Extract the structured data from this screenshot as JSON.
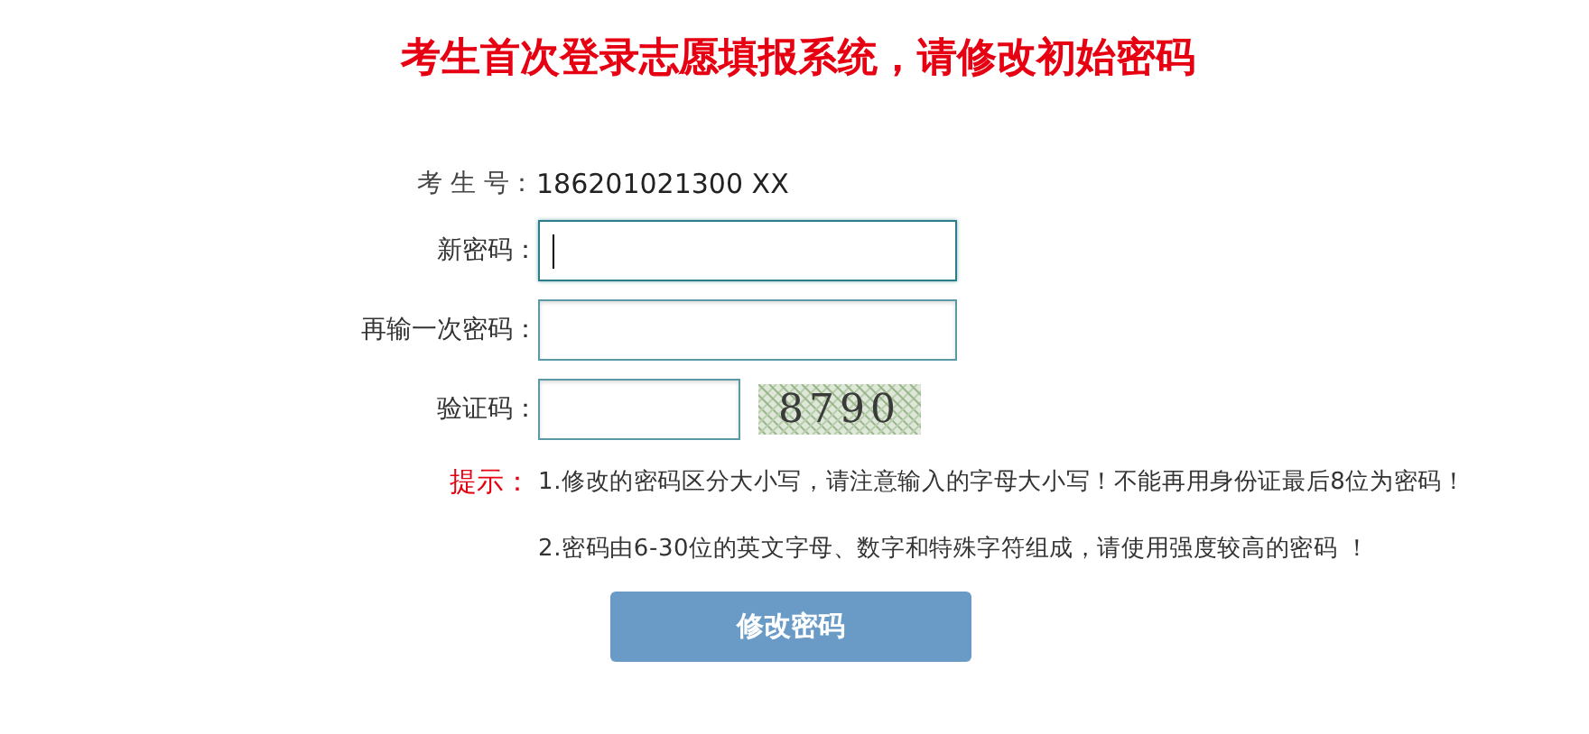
{
  "title": "考生首次登录志愿填报系统，请修改初始密码",
  "candidate": {
    "label": "考 生 号：",
    "value": "186201021300 XX"
  },
  "fields": [
    {
      "kind": "password",
      "label": "新密码：",
      "focused": true
    },
    {
      "kind": "password",
      "label": "再输一次密码：",
      "focused": false
    },
    {
      "kind": "captcha",
      "label": "验证码：",
      "focused": false,
      "captcha": "8790"
    }
  ],
  "tips": {
    "label": "提示：",
    "lines": [
      "1.修改的密码区分大小写，请注意输入的字母大小写！不能再用身份证最后8位为密码！",
      "2.密码由6-30位的英文字母、数字和特殊字符组成，请使用强度较高的密码 ！"
    ]
  },
  "submit_button": "修改密码"
}
